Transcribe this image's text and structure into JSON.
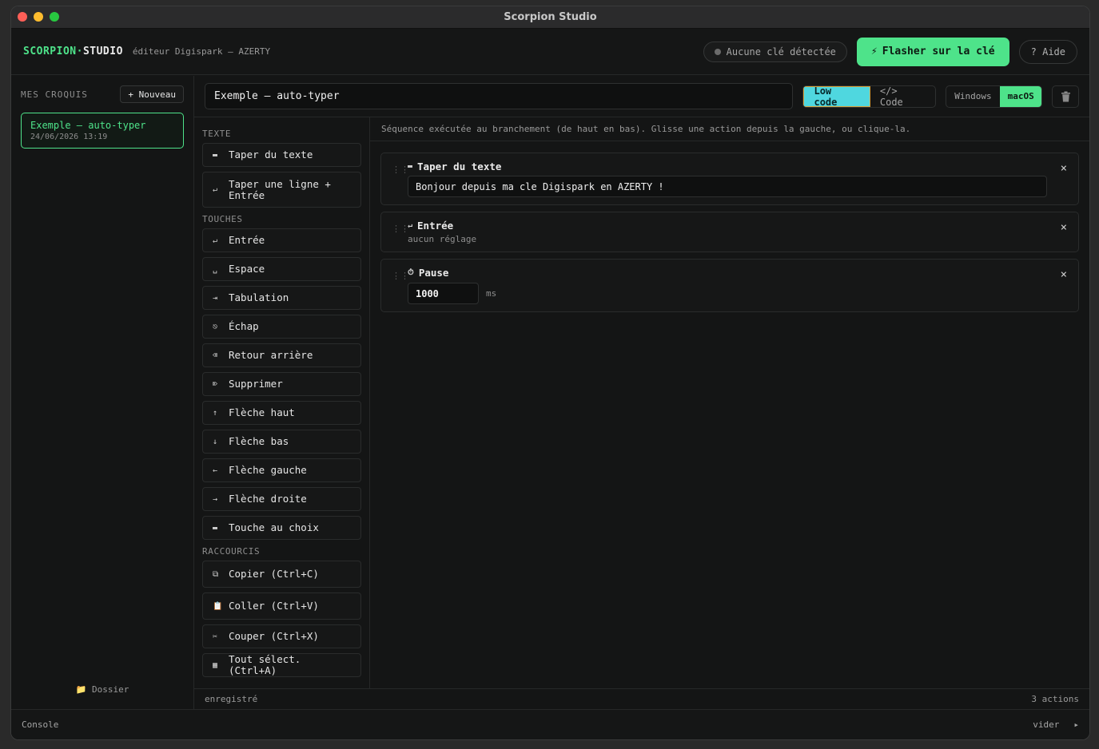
{
  "window": {
    "title": "Scorpion Studio"
  },
  "header": {
    "brand_part1": "SCORPION·",
    "brand_part2": "STUDIO",
    "subtitle": "éditeur Digispark — AZERTY",
    "status": "Aucune clé détectée",
    "flash_icon": "⚡",
    "flash_label": "Flasher sur la clé",
    "help_label": "? Aide"
  },
  "sidebar": {
    "title": "MES CROQUIS",
    "new_label": "+ Nouveau",
    "sketches": [
      {
        "name": "Exemple — auto-typer",
        "date": "24/06/2026 13:19"
      }
    ],
    "folder_label": "📁 Dossier"
  },
  "toolbar": {
    "sketch_name": "Exemple — auto-typer",
    "mode_lowcode": "Low code",
    "mode_code": "</> Code",
    "os_windows": "Windows",
    "os_macos": "macOS"
  },
  "palette": {
    "sections": [
      {
        "title": "TEXTE",
        "items": [
          {
            "icon": "▬",
            "label": "Taper du texte"
          },
          {
            "icon": "↵",
            "label": "Taper une ligne + Entrée"
          }
        ]
      },
      {
        "title": "TOUCHES",
        "items": [
          {
            "icon": "↵",
            "label": "Entrée"
          },
          {
            "icon": "␣",
            "label": "Espace"
          },
          {
            "icon": "⇥",
            "label": "Tabulation"
          },
          {
            "icon": "⎋",
            "label": "Échap"
          },
          {
            "icon": "⌫",
            "label": "Retour arrière"
          },
          {
            "icon": "⌦",
            "label": "Supprimer"
          },
          {
            "icon": "↑",
            "label": "Flèche haut"
          },
          {
            "icon": "↓",
            "label": "Flèche bas"
          },
          {
            "icon": "←",
            "label": "Flèche gauche"
          },
          {
            "icon": "→",
            "label": "Flèche droite"
          },
          {
            "icon": "▬",
            "label": "Touche au choix"
          }
        ]
      },
      {
        "title": "RACCOURCIS",
        "items": [
          {
            "icon": "⧉",
            "label": "Copier (Ctrl+C)"
          },
          {
            "icon": "📋",
            "label": "Coller (Ctrl+V)"
          },
          {
            "icon": "✂",
            "label": "Couper (Ctrl+X)"
          },
          {
            "icon": "▦",
            "label": "Tout sélect. (Ctrl+A)"
          }
        ]
      }
    ]
  },
  "canvas": {
    "hint": "Séquence exécutée au branchement (de haut en bas). Glisse une action depuis la gauche, ou clique-la.",
    "actions": [
      {
        "icon": "▬",
        "title": "Taper du texte",
        "value": "Bonjour depuis ma cle Digispark en AZERTY !"
      },
      {
        "icon": "↵",
        "title": "Entrée",
        "sub": "aucun réglage"
      },
      {
        "icon": "⏱",
        "title": "Pause",
        "value": "1000",
        "unit": "ms"
      }
    ],
    "close_glyph": "×",
    "drag_glyph": "⋮⋮"
  },
  "footer": {
    "status": "enregistré",
    "count": "3 actions"
  },
  "console": {
    "label": "Console",
    "clear": "vider",
    "toggle": "▸"
  }
}
